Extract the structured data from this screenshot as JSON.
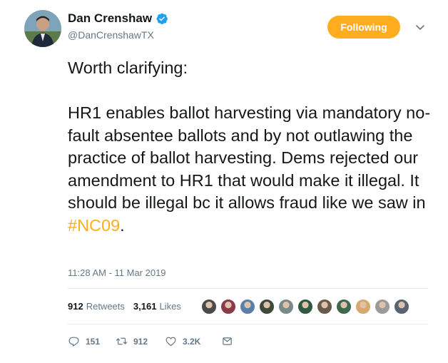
{
  "author": {
    "display_name": "Dan Crenshaw",
    "handle": "@DanCrenshawTX",
    "verified_icon": "verified-badge-icon",
    "avatar_icon": "user-avatar"
  },
  "follow_button": {
    "label": "Following",
    "color": "#ffad1f"
  },
  "tweet": {
    "text_main": "Worth clarifying:\n\nHR1 enables ballot harvesting via mandatory no-fault absentee ballots and by not outlawing the practice of ballot harvesting. Dems rejected our amendment to HR1 that would make it illegal. It should be illegal bc it allows fraud like we saw in ",
    "hashtag": "#NC09",
    "text_end": ".",
    "timestamp": "11:28 AM - 11 Mar 2019"
  },
  "stats": {
    "retweets_count": "912",
    "retweets_label": "Retweets",
    "likes_count": "3,161",
    "likes_label": "Likes"
  },
  "likers": [
    {
      "color": "#4a4a4a"
    },
    {
      "color": "#8a3a4a"
    },
    {
      "color": "#5a7fa8"
    },
    {
      "color": "#3f4a3a"
    },
    {
      "color": "#7a8a8a"
    },
    {
      "color": "#2f5a3f"
    },
    {
      "color": "#6a5a4a"
    },
    {
      "color": "#3d6a4d"
    },
    {
      "color": "#d8a870"
    },
    {
      "color": "#9a9a9a"
    },
    {
      "color": "#5a6470"
    }
  ],
  "actions": {
    "reply_count": "151",
    "retweet_count": "912",
    "like_count": "3.2K"
  },
  "colors": {
    "accent": "#ffad1f",
    "text": "#14171a",
    "secondary": "#657786",
    "verified": "#1da1f2"
  }
}
